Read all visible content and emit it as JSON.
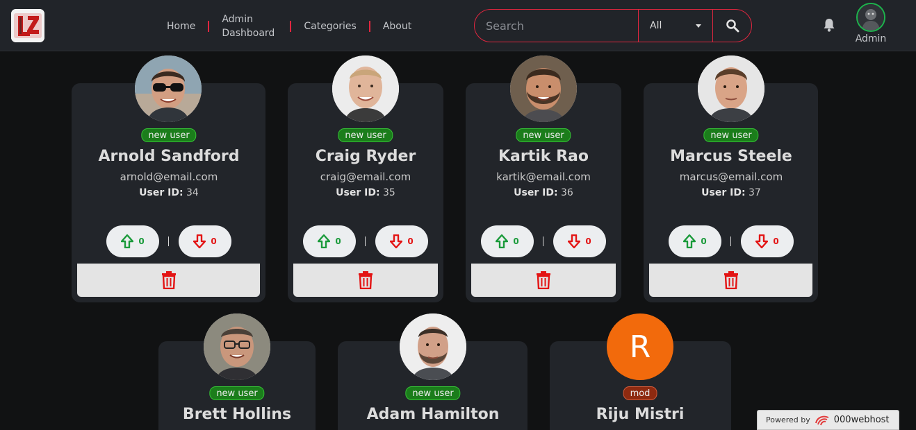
{
  "header": {
    "nav": [
      "Home",
      "Admin Dashboard",
      "Categories",
      "About"
    ],
    "search": {
      "placeholder": "Search",
      "category": "All"
    },
    "admin_label": "Admin"
  },
  "users": [
    {
      "name": "Arnold Sandford",
      "email": "arnold@email.com",
      "id_label": "User ID:",
      "id": "34",
      "badge": "new user",
      "upvotes": "0",
      "downvotes": "0"
    },
    {
      "name": "Craig Ryder",
      "email": "craig@email.com",
      "id_label": "User ID:",
      "id": "35",
      "badge": "new user",
      "upvotes": "0",
      "downvotes": "0"
    },
    {
      "name": "Kartik Rao",
      "email": "kartik@email.com",
      "id_label": "User ID:",
      "id": "36",
      "badge": "new user",
      "upvotes": "0",
      "downvotes": "0"
    },
    {
      "name": "Marcus Steele",
      "email": "marcus@email.com",
      "id_label": "User ID:",
      "id": "37",
      "badge": "new user",
      "upvotes": "0",
      "downvotes": "0"
    },
    {
      "name": "Brett Hollins",
      "badge": "new user"
    },
    {
      "name": "Adam Hamilton",
      "badge": "new user"
    },
    {
      "name": "Riju Mistri",
      "badge": "mod",
      "avatar_letter": "R"
    }
  ],
  "footer": {
    "powered_by": "Powered by",
    "host": "000webhost"
  },
  "colors": {
    "accent": "#e0263f",
    "up": "#1a9a3a",
    "down": "#e31414",
    "new_badge": "#1b7d1b",
    "mod_badge": "#8e2a10",
    "letter_avatar": "#f26a0c"
  }
}
